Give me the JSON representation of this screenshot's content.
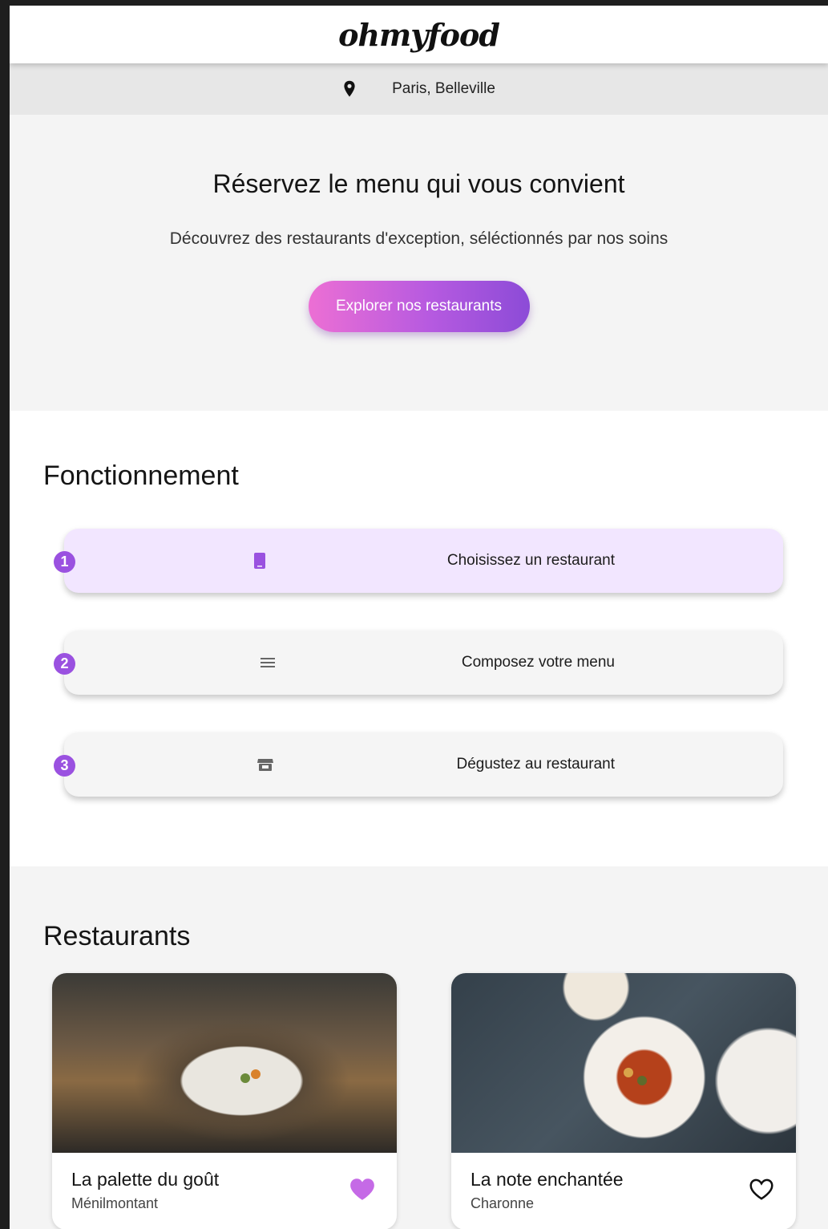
{
  "header": {
    "logo": "ohmyfood"
  },
  "location": {
    "icon": "location-pin-icon",
    "text": "Paris, Belleville"
  },
  "hero": {
    "title": "Réservez le menu qui vous convient",
    "subtitle": "Découvrez des restaurants d'exception, séléctionnés par nos soins",
    "cta_label": "Explorer nos restaurants"
  },
  "how": {
    "title": "Fonctionnement",
    "steps": [
      {
        "number": "1",
        "icon": "mobile-icon",
        "label": "Choisissez un restaurant",
        "active": true
      },
      {
        "number": "2",
        "icon": "list-icon",
        "label": "Composez votre menu",
        "active": false
      },
      {
        "number": "3",
        "icon": "store-icon",
        "label": "Dégustez au restaurant",
        "active": false
      }
    ]
  },
  "restaurants": {
    "title": "Restaurants",
    "items": [
      {
        "name": "La palette du goût",
        "area": "Ménilmontant",
        "liked": true
      },
      {
        "name": "La note enchantée",
        "area": "Charonne",
        "liked": false
      }
    ]
  },
  "colors": {
    "accent": "#9a51e0",
    "gradient_start": "#ec6fd4",
    "gradient_end": "#8c4bd7",
    "heart_filled": "#c56ae6"
  }
}
